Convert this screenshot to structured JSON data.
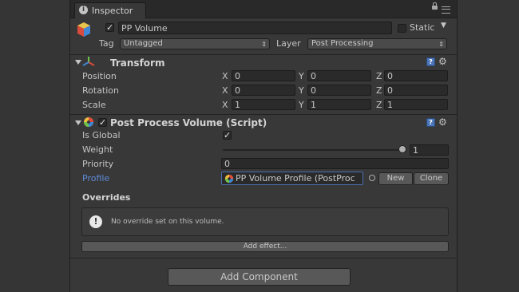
{
  "window": {
    "tab_label": "Inspector"
  },
  "gameobject": {
    "name": "PP Volume",
    "static_label": "Static",
    "tag_label": "Tag",
    "tag_value": "Untagged",
    "layer_label": "Layer",
    "layer_value": "Post Processing"
  },
  "transform": {
    "title": "Transform",
    "rows": [
      {
        "label": "Position",
        "x": "0",
        "y": "0",
        "z": "0"
      },
      {
        "label": "Rotation",
        "x": "0",
        "y": "0",
        "z": "0"
      },
      {
        "label": "Scale",
        "x": "1",
        "y": "1",
        "z": "1"
      }
    ],
    "axis_labels": {
      "x": "X",
      "y": "Y",
      "z": "Z"
    }
  },
  "ppvolume": {
    "title": "Post Process Volume (Script)",
    "is_global_label": "Is Global",
    "weight_label": "Weight",
    "weight_value": "1",
    "priority_label": "Priority",
    "priority_value": "0",
    "profile_label": "Profile",
    "profile_value": "PP Volume Profile (PostProc",
    "new_label": "New",
    "clone_label": "Clone",
    "overrides_label": "Overrides",
    "no_override_message": "No override set on this volume.",
    "add_effect_label": "Add effect..."
  },
  "footer": {
    "add_component_label": "Add Component"
  },
  "colors": {
    "panel": "#383838",
    "link": "#5f8ad8",
    "help": "#4c76b8"
  }
}
